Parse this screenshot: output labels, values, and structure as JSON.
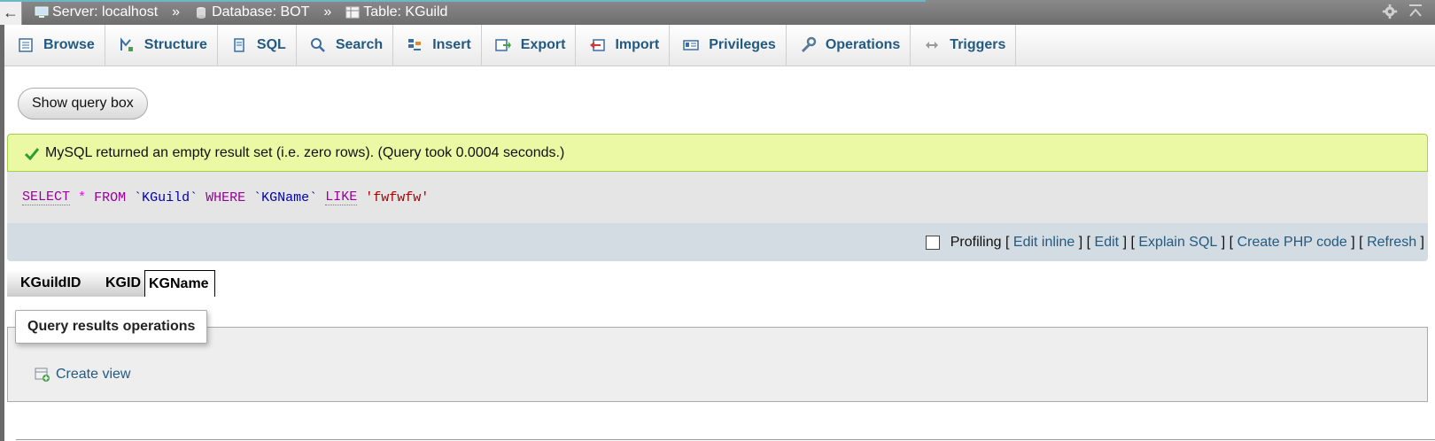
{
  "breadcrumb": {
    "back_symbol": "←",
    "server": "Server: localhost",
    "sep1": "»",
    "database": "Database: BOT",
    "sep2": "»",
    "table": "Table: KGuild"
  },
  "tabs": [
    {
      "label": "Browse",
      "icon": "browse-icon"
    },
    {
      "label": "Structure",
      "icon": "structure-icon"
    },
    {
      "label": "SQL",
      "icon": "sql-icon"
    },
    {
      "label": "Search",
      "icon": "search-icon"
    },
    {
      "label": "Insert",
      "icon": "insert-icon"
    },
    {
      "label": "Export",
      "icon": "export-icon"
    },
    {
      "label": "Import",
      "icon": "import-icon"
    },
    {
      "label": "Privileges",
      "icon": "privileges-icon"
    },
    {
      "label": "Operations",
      "icon": "operations-icon"
    },
    {
      "label": "Triggers",
      "icon": "triggers-icon"
    }
  ],
  "query_box_button": "Show query box",
  "message": {
    "text": "MySQL returned an empty result set (i.e. zero rows). (Query took 0.0004 seconds.)"
  },
  "sql": {
    "select": "SELECT",
    "star": "*",
    "from": "FROM",
    "table": "`KGuild`",
    "where": "WHERE",
    "column": "`KGName`",
    "like": "LIKE",
    "value": "'fwfwfw'"
  },
  "tools": {
    "profiling": "Profiling",
    "open_bracket": "[",
    "close_bracket": "]",
    "edit_inline": "Edit inline",
    "edit": "Edit",
    "explain_sql": "Explain SQL",
    "create_php_code": "Create PHP code",
    "refresh": "Refresh"
  },
  "columns": [
    "KGuildID",
    "KGID",
    "KGName"
  ],
  "operations": {
    "legend": "Query results operations",
    "create_view": "Create view"
  },
  "colors": {
    "accent_link": "#235a81",
    "success_bg": "#ebf8a4",
    "tools_bg": "#d3dce3"
  }
}
